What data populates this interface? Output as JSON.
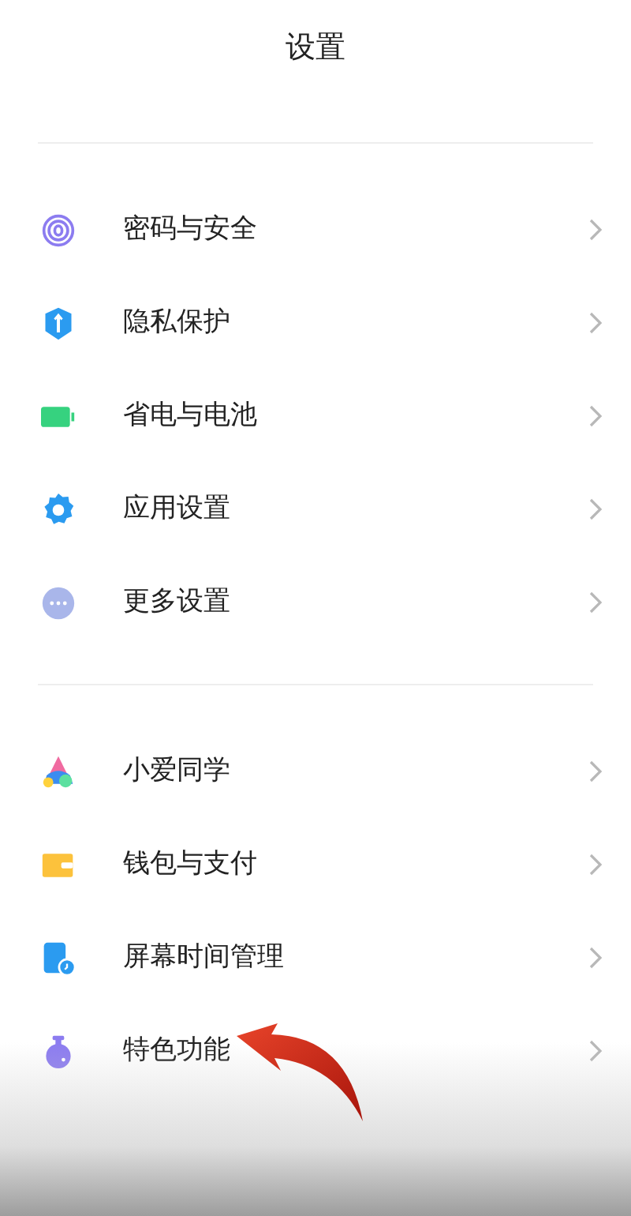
{
  "title": "设置",
  "sections": [
    {
      "items": [
        {
          "label": "密码与安全",
          "kind": "fingerprint"
        },
        {
          "label": "隐私保护",
          "kind": "shield"
        },
        {
          "label": "省电与电池",
          "kind": "battery"
        },
        {
          "label": "应用设置",
          "kind": "gear"
        },
        {
          "label": "更多设置",
          "kind": "dots"
        }
      ]
    },
    {
      "items": [
        {
          "label": "小爱同学",
          "kind": "assistant"
        },
        {
          "label": "钱包与支付",
          "kind": "wallet"
        },
        {
          "label": "屏幕时间管理",
          "kind": "screentime"
        },
        {
          "label": "特色功能",
          "kind": "flask"
        }
      ]
    }
  ],
  "annotation": {
    "kind": "arrow"
  }
}
